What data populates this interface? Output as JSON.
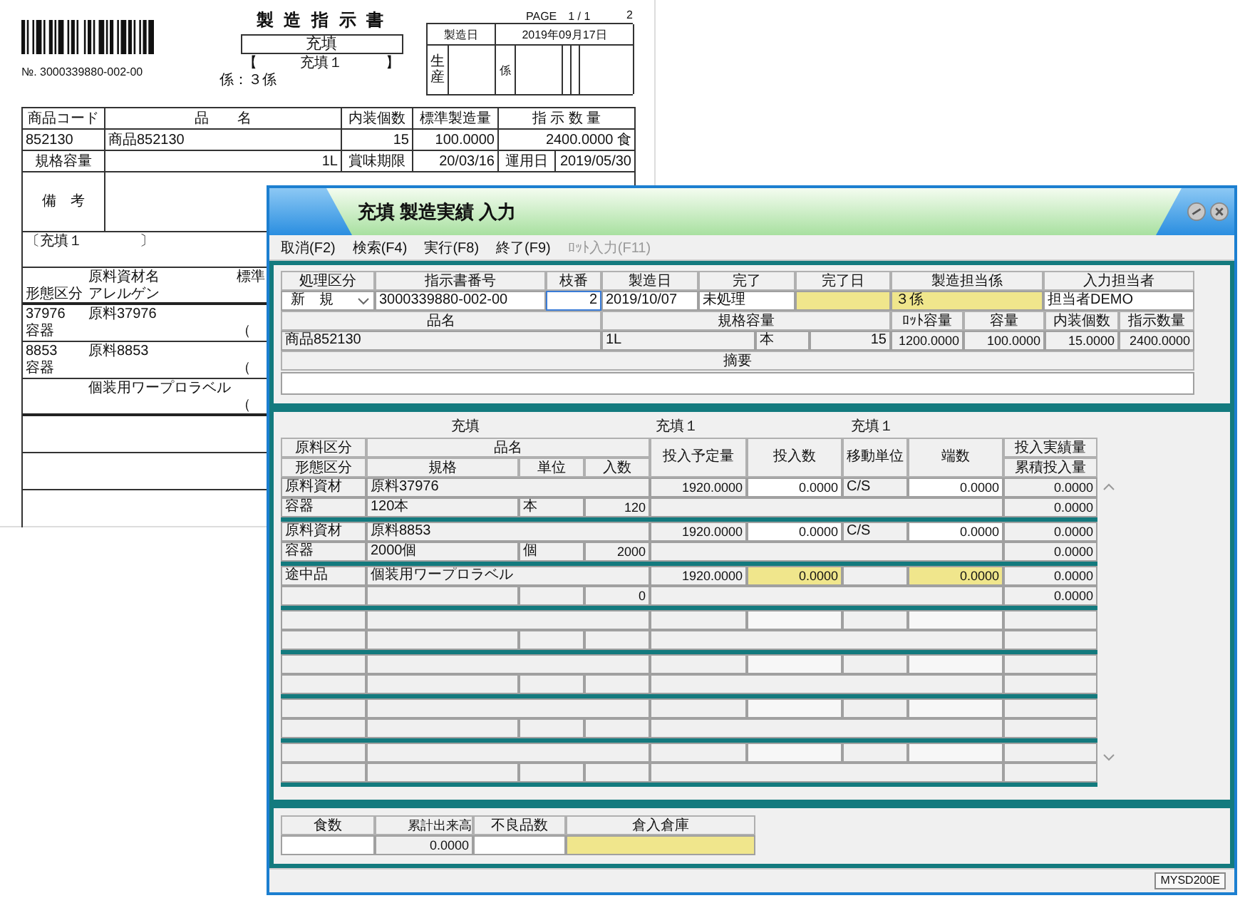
{
  "document": {
    "number": "№. 3000339880-002-00",
    "title": "製 造 指 示 書",
    "process": "充填",
    "bracket_open": "【",
    "bracket_label": "充填１",
    "bracket_close": "】",
    "staff": "係：３係",
    "page": "PAGE　1 / 1",
    "page_extra": "2",
    "date_label": "製造日",
    "date": "2019年09月17日",
    "production_label": "生産",
    "staff_label": "係",
    "columns": [
      "商品コード",
      "品　　名",
      "内装個数",
      "標準製造量",
      "指 示 数 量"
    ],
    "row": [
      "852130",
      "商品852130",
      "15",
      "100.0000",
      "2400.0000 食"
    ],
    "spec_row": [
      "規格容量",
      "1L",
      "賞味期限",
      "20/03/16",
      "運用日",
      "2019/05/30"
    ],
    "remarks_label": "備　考",
    "process_line": "〔充填１　　　　〕",
    "materials_header": [
      "原料資材名",
      "標準",
      "形態区分",
      "アレルゲン"
    ],
    "materials": [
      {
        "code": "37976",
        "name": "原料37976",
        "form": "容器",
        "paren": "（"
      },
      {
        "code": "8853",
        "name": "原料8853",
        "form": "容器",
        "paren": "（"
      },
      {
        "name": "個装用ワープロラベル",
        "paren": "（"
      }
    ]
  },
  "window": {
    "title": "充填 製造実績 入力",
    "menu": [
      {
        "label": "取消(F2)",
        "disabled": false
      },
      {
        "label": "検索(F4)",
        "disabled": false
      },
      {
        "label": "実行(F8)",
        "disabled": false
      },
      {
        "label": "終了(F9)",
        "disabled": false
      },
      {
        "label": "ﾛｯﾄ入力(F11)",
        "disabled": true
      }
    ]
  },
  "header": {
    "labels": [
      "処理区分",
      "指示書番号",
      "枝番",
      "製造日",
      "完了",
      "完了日",
      "製造担当係",
      "入力担当者"
    ],
    "mode": "新　規",
    "order_no": "3000339880-002-00",
    "branch": {
      "value": "2",
      "focused": true
    },
    "date": "2019/10/07",
    "done": "未処理",
    "tanto": "３係",
    "inputter": "担当者DEMO",
    "labels2": [
      "品名",
      "規格容量",
      "ﾛｯﾄ容量",
      "容量",
      "内装個数",
      "指示数量"
    ],
    "values2": [
      "商品852130",
      "1L",
      "本",
      "15",
      "1200.0000",
      "100.0000",
      "15.0000",
      "2400.0000"
    ],
    "memo_label": "摘要"
  },
  "table": {
    "captions": [
      "充填",
      "充填１",
      "充填１"
    ],
    "head": [
      "原料区分",
      "品名",
      "投入予定量",
      "投入数",
      "移動単位",
      "端数",
      "投入実績量"
    ],
    "head2": [
      "形態区分",
      "規格",
      "単位",
      "入数",
      "累積投入量"
    ],
    "groups": [
      {
        "kind": "item",
        "highlighted": false,
        "type": "原料資材",
        "name": "原料37976",
        "planned": "1920.0000",
        "qty": "0.0000",
        "unit": "C/S",
        "fraction": "0.0000",
        "actual": "0.0000",
        "form": "容器",
        "spec": "120本",
        "spec_unit": "本",
        "count": "120",
        "total": "0.0000"
      },
      {
        "kind": "item",
        "highlighted": false,
        "type": "原料資材",
        "name": "原料8853",
        "planned": "1920.0000",
        "qty": "0.0000",
        "unit": "C/S",
        "fraction": "0.0000",
        "actual": "0.0000",
        "form": "容器",
        "spec": "2000個",
        "spec_unit": "個",
        "count": "2000",
        "total": "0.0000"
      },
      {
        "kind": "item",
        "highlighted": true,
        "type": "途中品",
        "name": "個装用ワープロラベル",
        "planned": "1920.0000",
        "qty": "0.0000",
        "fraction": "0.0000",
        "actual": "0.0000",
        "count": "0",
        "total": "0.0000"
      },
      {
        "kind": "blank"
      },
      {
        "kind": "blank"
      },
      {
        "kind": "blank"
      },
      {
        "kind": "blank"
      }
    ]
  },
  "footer": {
    "labels": [
      "食数",
      "累計出来高",
      "不良品数",
      "倉入倉庫"
    ],
    "total": "0.0000"
  },
  "status_code": "MYSD200E"
}
